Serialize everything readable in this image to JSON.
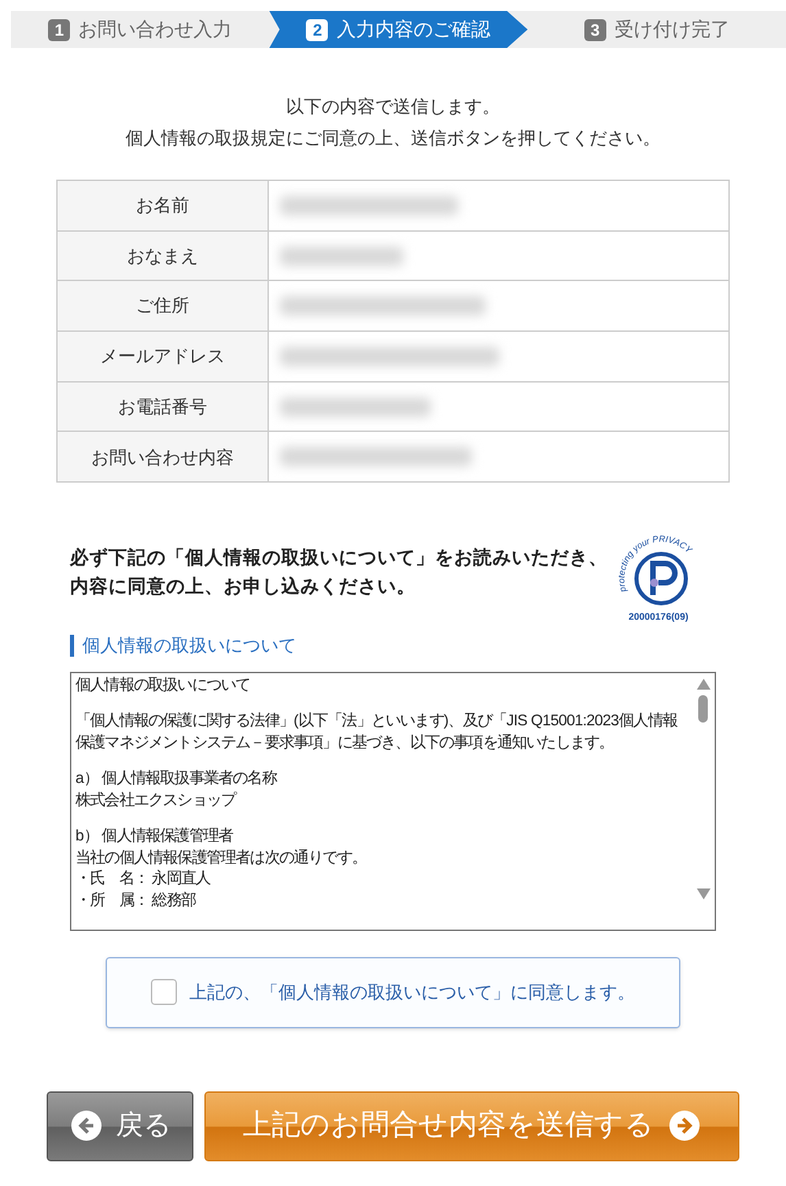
{
  "steps": [
    {
      "number": "1",
      "label": "お問い合わせ入力",
      "selected": false
    },
    {
      "number": "2",
      "label": "入力内容のご確認",
      "selected": true
    },
    {
      "number": "3",
      "label": "受け付け完了",
      "selected": false
    }
  ],
  "intro": [
    "以下の内容で送信します。",
    "個人情報の取扱規定にご同意の上、送信ボタンを押してください。"
  ],
  "table": {
    "rows": [
      {
        "label": "お名前"
      },
      {
        "label": "おなまえ"
      },
      {
        "label": "ご住所"
      },
      {
        "label": "メールアドレス"
      },
      {
        "label": "お電話番号"
      },
      {
        "label": "お問い合わせ内容"
      }
    ]
  },
  "notice": [
    "必ず下記の「個人情報の取扱いについて」をお読みいただき、",
    "内容に同意の上、お申し込みください。"
  ],
  "privacy_mark": {
    "arc_text": "protecting your PRIVACY",
    "number": "20000176(09)"
  },
  "policy": {
    "heading": "個人情報の取扱いについて",
    "paragraphs": [
      [
        "個人情報の取扱いについて"
      ],
      [
        "「個人情報の保護に関する法律」(以下「法」といいます)、及び「JIS Q15001:2023個人情報保護マネジメントシステム－要求事項」に基づき、以下の事項を通知いたします。"
      ],
      [
        "a） 個人情報取扱事業者の名称",
        "株式会社エクスショップ"
      ],
      [
        "b） 個人情報保護管理者",
        "当社の個人情報保護管理者は次の通りです。",
        "・氏　名： 永岡直人",
        "・所　属： 総務部"
      ]
    ]
  },
  "agree": {
    "label": "上記の、「個人情報の取扱いについて」に同意します。",
    "checked": false
  },
  "buttons": [
    {
      "kind": "back",
      "label": "戻る"
    },
    {
      "kind": "submit",
      "label": "上記のお問合せ内容を送信する"
    }
  ]
}
